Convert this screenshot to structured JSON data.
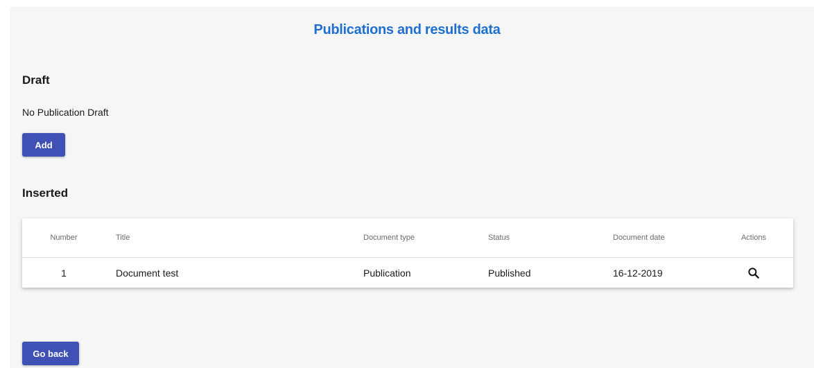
{
  "page": {
    "title": "Publications and results data"
  },
  "draft": {
    "heading": "Draft",
    "empty_text": "No Publication Draft",
    "add_label": "Add"
  },
  "inserted": {
    "heading": "Inserted",
    "columns": [
      "Number",
      "Title",
      "Document type",
      "Status",
      "Document date",
      "Actions"
    ],
    "rows": [
      {
        "number": "1",
        "title": "Document test",
        "document_type": "Publication",
        "status": "Published",
        "document_date": "16-12-2019",
        "action_icon": "search-icon"
      }
    ]
  },
  "footer": {
    "back_label": "Go back"
  },
  "colors": {
    "title": "#1f6fd1",
    "button": "#3f51b5",
    "background": "#f6f6f6"
  }
}
